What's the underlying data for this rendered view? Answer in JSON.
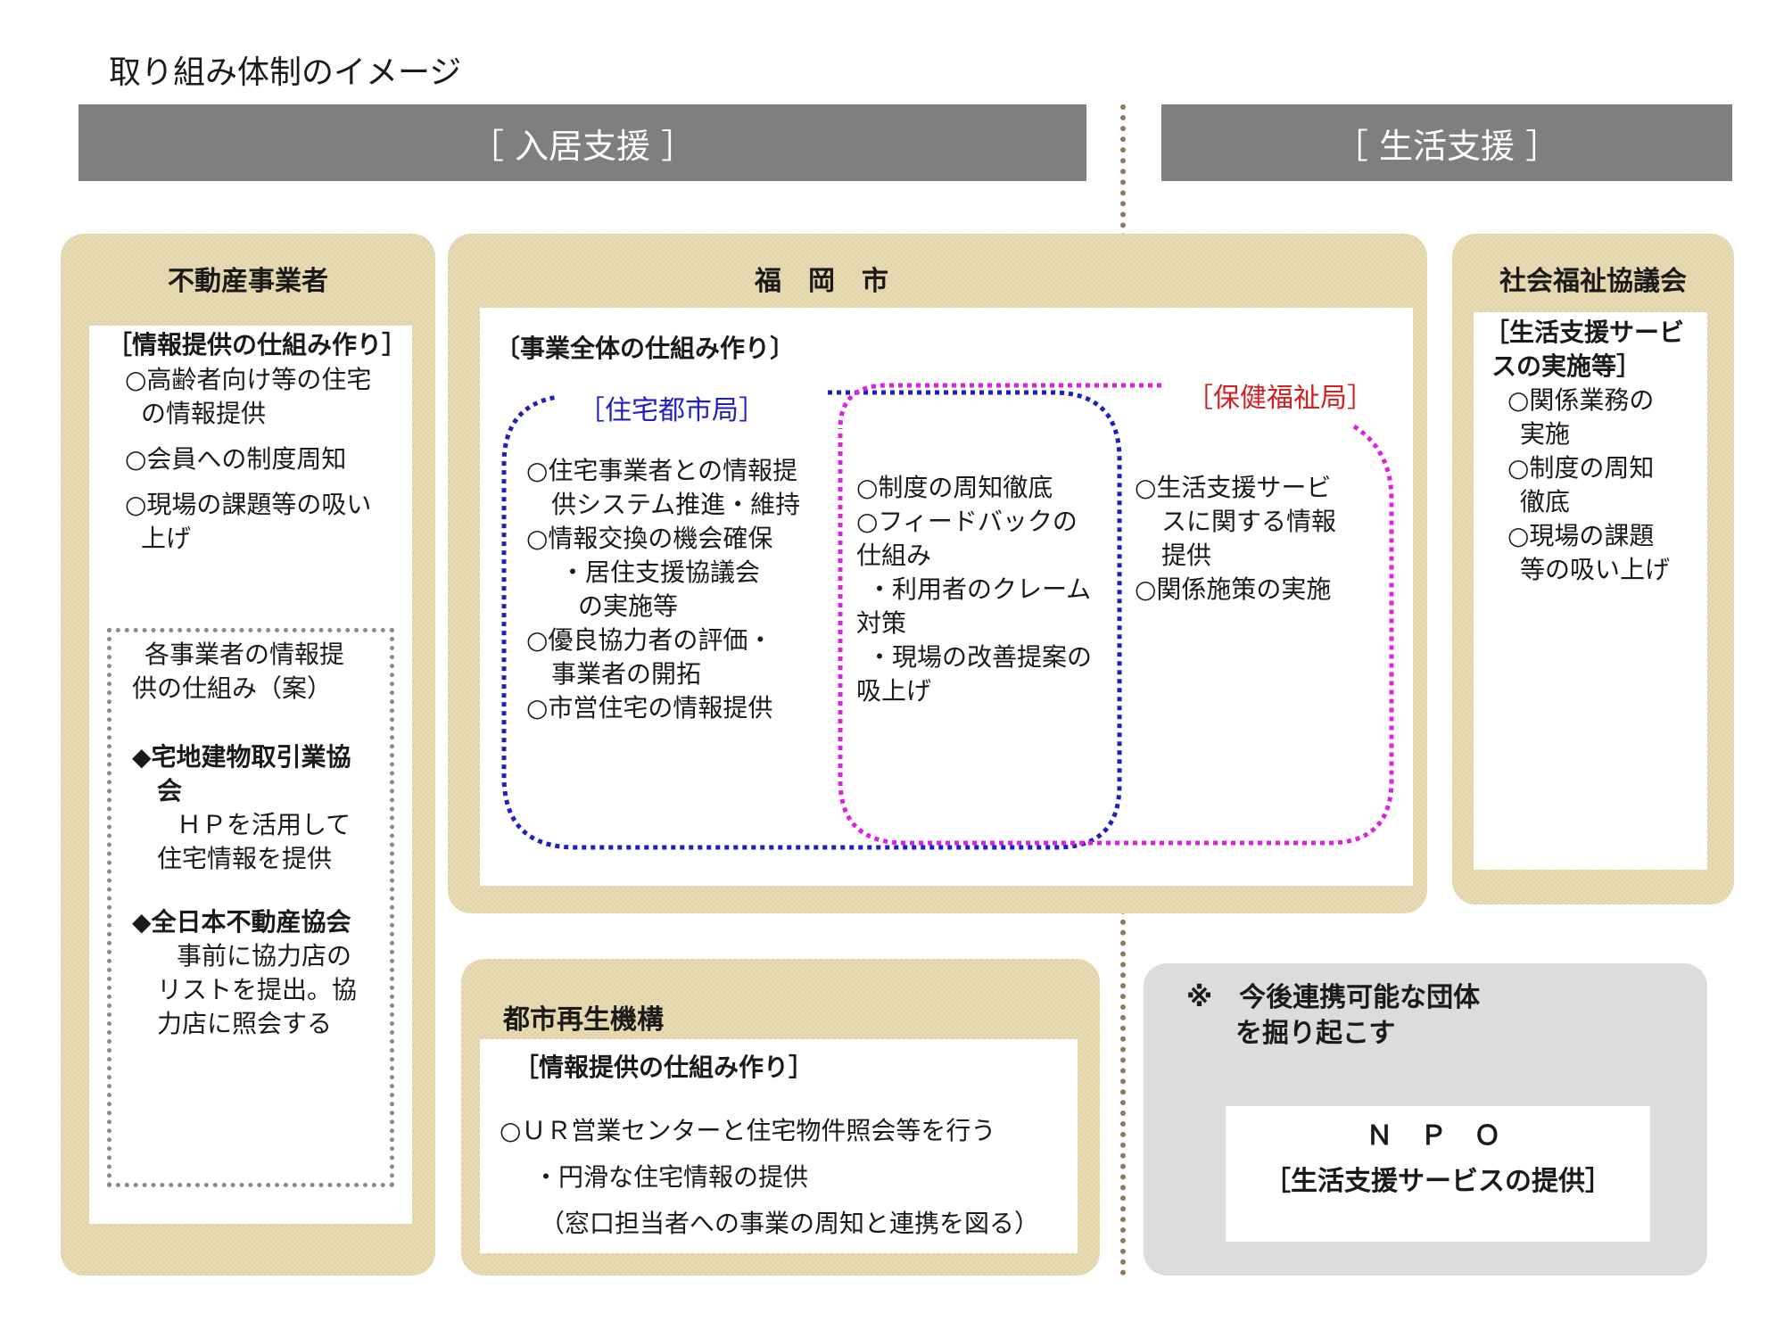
{
  "title": "取り組み体制のイメージ",
  "headers": {
    "left": "［ 入居支援 ］",
    "right": "［ 生活支援 ］"
  },
  "realestate": {
    "heading": "不動産事業者",
    "sub": "［情報提供の仕組み作り］",
    "items": [
      "○高齢者向け等の住宅",
      "の情報提供",
      "○会員への制度周知",
      "○現場の課題等の吸い",
      "上げ"
    ],
    "inner": {
      "title_l1": "各事業者の情報提",
      "title_l2": "供の仕組み（案）",
      "a_l1": "◆宅地建物取引業協",
      "a_l2": "会",
      "a_l3": "ＨＰを活用して",
      "a_l4": "住宅情報を提供",
      "b_l1": "◆全日本不動産協会",
      "b_l2": "事前に協力店の",
      "b_l3": "リストを提出。協",
      "b_l4": "力店に照会する"
    }
  },
  "city": {
    "heading": "福　岡　市",
    "sub": "〔事業全体の仕組み作り〕",
    "housing_label": "［住宅都市局］",
    "welfare_label": "［保健福祉局］",
    "housing_items": [
      "○住宅事業者との情報提",
      "供システム推進・維持",
      "○情報交換の機会確保",
      "・居住支援協議会",
      "の実施等",
      "○優良協力者の評価・",
      "事業者の開拓",
      "○市営住宅の情報提供"
    ],
    "shared_items": [
      "○制度の周知徹底",
      "○フィードバックの",
      "仕組み",
      "・利用者のクレーム",
      "対策",
      "・現場の改善提案の",
      "吸上げ"
    ],
    "welfare_items": [
      "○生活支援サービ",
      "スに関する情報",
      "提供",
      "○関係施策の実施"
    ]
  },
  "council": {
    "heading": "社会福祉協議会",
    "sub_l1": "［生活支援サービ",
    "sub_l2": "スの実施等］",
    "items": [
      "○関係業務の",
      "実施",
      "○制度の周知",
      "徹底",
      "○現場の課題",
      "等の吸い上げ"
    ]
  },
  "ur": {
    "heading": "都市再生機構",
    "sub": "［情報提供の仕組み作り］",
    "items": [
      "○ＵＲ営業センターと住宅物件照会等を行う",
      "・円滑な住宅情報の提供",
      "（窓口担当者への事業の周知と連携を図る）"
    ]
  },
  "npo": {
    "note_l1": "※　今後連携可能な団体",
    "note_l2": "を掘り起こす",
    "name": "Ｎ Ｐ Ｏ",
    "role": "［生活支援サービスの提供］"
  },
  "colors": {
    "header": "#7f7f7f",
    "tan": "#e3d4a8",
    "housing": "#1f1fbf",
    "welfare": "#e020e0",
    "welfare_label": "#d42020"
  }
}
